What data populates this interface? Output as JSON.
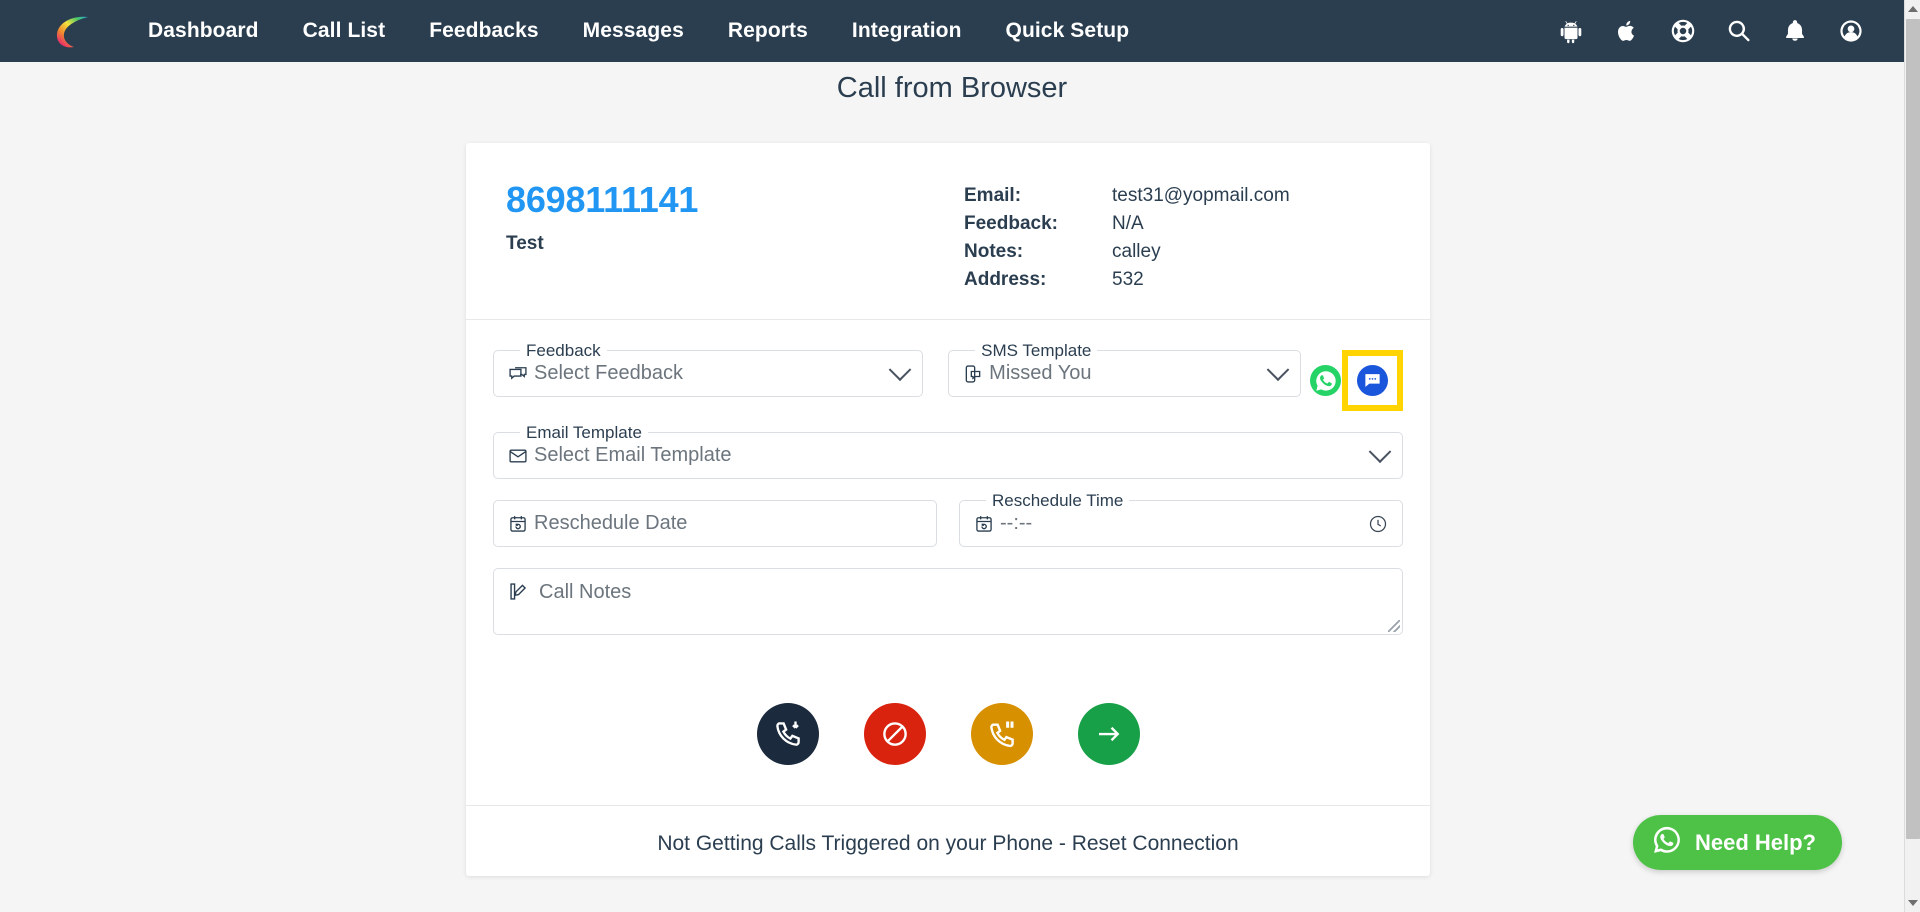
{
  "navbar": {
    "brand_name": "calley-logo",
    "links": [
      {
        "label": "Dashboard"
      },
      {
        "label": "Call List"
      },
      {
        "label": "Feedbacks"
      },
      {
        "label": "Messages"
      },
      {
        "label": "Reports"
      },
      {
        "label": "Integration"
      },
      {
        "label": "Quick Setup"
      }
    ],
    "icons": [
      {
        "name": "android-icon"
      },
      {
        "name": "apple-icon"
      },
      {
        "name": "life-ring-support-icon"
      },
      {
        "name": "search-icon"
      },
      {
        "name": "bell-notification-icon"
      },
      {
        "name": "user-account-icon"
      }
    ],
    "background": "#2b3e50"
  },
  "page": {
    "title": "Call from Browser"
  },
  "contact": {
    "phone": "8698111141",
    "name": "Test",
    "details": [
      {
        "label": "Email:",
        "value": "test31@yopmail.com"
      },
      {
        "label": "Feedback:",
        "value": "N/A"
      },
      {
        "label": "Notes:",
        "value": "calley"
      },
      {
        "label": "Address:",
        "value": "532"
      }
    ],
    "phone_color": "#2196f3"
  },
  "form": {
    "feedback": {
      "legend": "Feedback",
      "value": "Select Feedback",
      "icon": "feedback-comment-icon"
    },
    "sms_template": {
      "legend": "SMS Template",
      "value": "Missed You",
      "icon": "sms-device-icon"
    },
    "email_template": {
      "legend": "Email Template",
      "value": "Select Email Template",
      "icon": "envelope-icon"
    },
    "reschedule_date": {
      "legend": "",
      "placeholder": "Reschedule Date",
      "icon": "calendar-refresh-icon"
    },
    "reschedule_time": {
      "legend": "Reschedule Time",
      "value": "--:--",
      "icon": "calendar-refresh-icon"
    },
    "call_notes": {
      "placeholder": "Call Notes",
      "icon": "phone-edit-icon"
    },
    "send_whatsapp": {
      "name": "whatsapp-send-button",
      "color": "#25d366"
    },
    "send_sms": {
      "name": "sms-send-button",
      "color": "#1a56db",
      "highlight_color": "#ffd400"
    }
  },
  "actions": [
    {
      "name": "callback-button",
      "color": "#1b2a3d",
      "icon": "phone-incoming-icon"
    },
    {
      "name": "reject-call-button",
      "color": "#d9230f",
      "icon": "block-circle-icon"
    },
    {
      "name": "hold-call-button",
      "color": "#d79000",
      "icon": "phone-pause-icon"
    },
    {
      "name": "next-call-button",
      "color": "#17a047",
      "icon": "arrow-right-icon"
    }
  ],
  "footer": {
    "reset_text": "Not Getting Calls Triggered on your Phone - Reset Connection"
  },
  "widget": {
    "need_help_label": "Need Help?",
    "color": "#4dc247",
    "icon": "whatsapp-icon"
  }
}
